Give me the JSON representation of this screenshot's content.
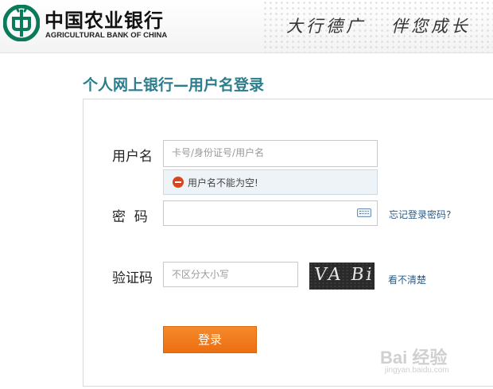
{
  "header": {
    "bank_name_cn": "中国农业银行",
    "bank_name_en": "AGRICULTURAL BANK OF CHINA",
    "slogan_1": "大行德广",
    "slogan_2": "伴您成长",
    "logo_icon": "abc-bank-logo-icon"
  },
  "page": {
    "title": "个人网上银行—用户名登录"
  },
  "form": {
    "username_label": "用户名",
    "username_placeholder": "卡号/身份证号/用户名",
    "username_error": "用户名不能为空!",
    "password_label": "密  码",
    "password_value": "",
    "keyboard_icon": "soft-keyboard-icon",
    "forgot_password": "忘记登录密码?",
    "captcha_label": "验证码",
    "captcha_placeholder": "不区分大小写",
    "captcha_image_text": "VA Bi",
    "captcha_refresh": "看不清楚",
    "login_button": "登录"
  },
  "watermark": {
    "text": "Bai 经验",
    "sub": "jingyan.baidu.com"
  },
  "colors": {
    "title": "#2b7e8c",
    "button": "#ec6e10",
    "link": "#2a5d8a",
    "logo": "#0a7a5a",
    "error": "#d9451f"
  }
}
